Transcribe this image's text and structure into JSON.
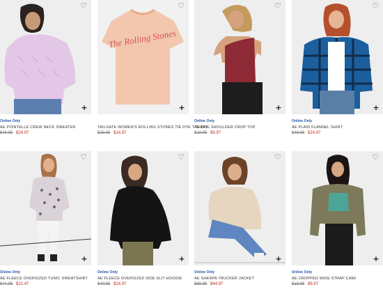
{
  "products": [
    {
      "badge": "Online Only",
      "title": "AE Pointelle Crew Neck Sweater",
      "old_price": "$49.95",
      "sale_price": "$24.97"
    },
    {
      "badge": "",
      "title": "Tailgate Women's Rolling Stones Tie Dye T-Shirt",
      "old_price": "$29.95",
      "sale_price": "$14.97"
    },
    {
      "badge": "Online Only",
      "title": "AE One Shoulder Crop Top",
      "old_price": "$19.95",
      "sale_price": "$9.97"
    },
    {
      "badge": "Online Only",
      "title": "AE Plaid Flannel Shirt",
      "old_price": "$49.95",
      "sale_price": "$24.97"
    },
    {
      "badge": "Online Only",
      "title": "AE Fleece Oversized Tunic Sweatshirt",
      "old_price": "$44.95",
      "sale_price": "$22.47"
    },
    {
      "badge": "Online Only",
      "title": "AE Fleece Oversized Side Slit Hoodie",
      "old_price": "$49.95",
      "sale_price": "$24.97"
    },
    {
      "badge": "Online Only",
      "title": "AE Sherpa Trucker Jacket",
      "old_price": "$89.95",
      "sale_price": "$44.97"
    },
    {
      "badge": "Online Only",
      "title": "AE Cropped Wide Strap Cami",
      "old_price": "$19.95",
      "sale_price": "$9.97"
    }
  ],
  "icons": {
    "favorite": "heart-outline-icon",
    "add": "plus-icon"
  },
  "graphic_text": "The Rolling Stones"
}
